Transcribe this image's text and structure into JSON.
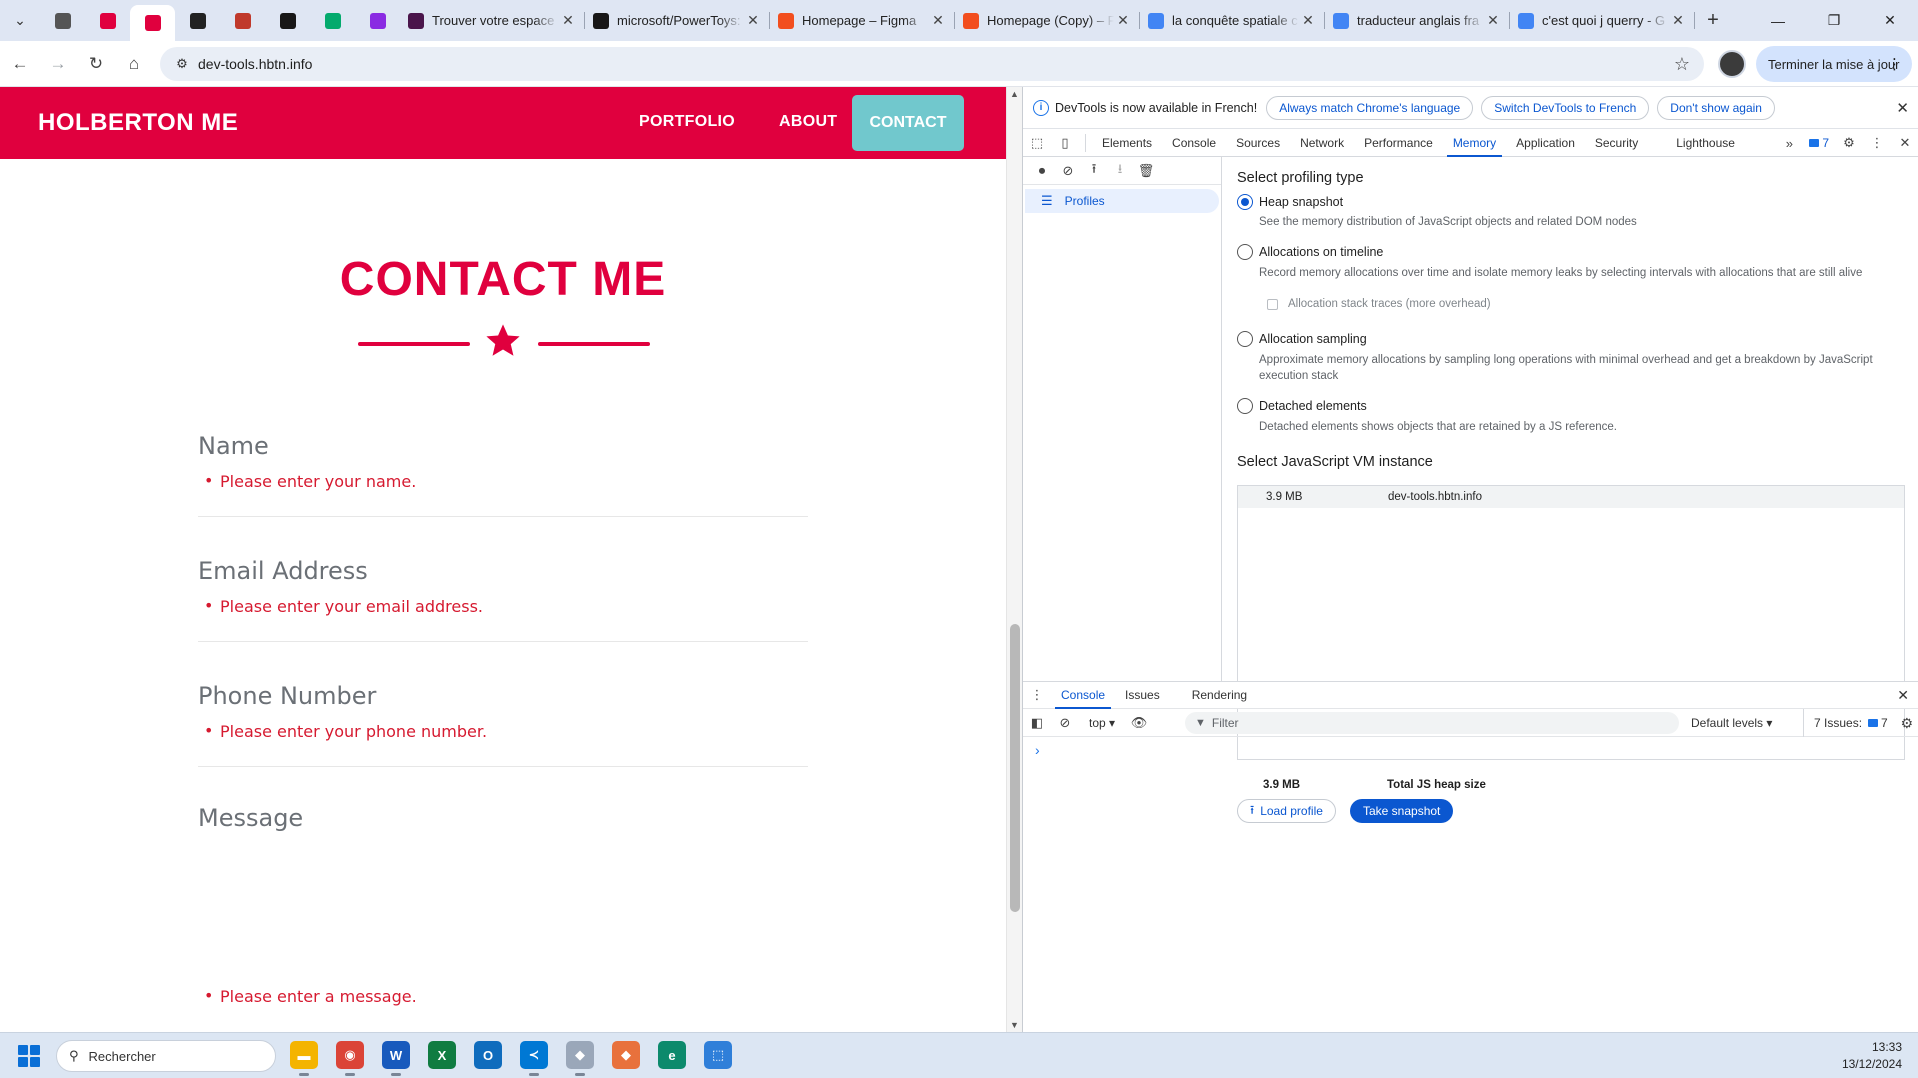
{
  "browser": {
    "pinned_tabs": [
      {
        "icon": "chrome-icon",
        "color": "#555555"
      },
      {
        "icon": "holberton-icon",
        "color": "#e0003e"
      },
      {
        "icon": "holberton-icon",
        "color": "#e0003e"
      },
      {
        "icon": "letter-l-icon",
        "color": "#222222"
      },
      {
        "icon": "clipboard-icon",
        "color": "#c0392b"
      },
      {
        "icon": "github-icon",
        "color": "#181717"
      },
      {
        "icon": "w3schools-icon",
        "color": "#04aa6d"
      },
      {
        "icon": "gem-icon",
        "color": "#8a2be2"
      }
    ],
    "tabs": [
      {
        "title": "Trouver votre espace",
        "icon": "slack-icon",
        "color": "#4a154b"
      },
      {
        "title": "microsoft/PowerToys:",
        "icon": "github-icon",
        "color": "#181717"
      },
      {
        "title": "Homepage – Figma",
        "icon": "figma-icon",
        "color": "#f24e1e"
      },
      {
        "title": "Homepage (Copy) – F",
        "icon": "figma-icon",
        "color": "#f24e1e"
      },
      {
        "title": "la conquête spatiale c",
        "icon": "google-icon",
        "color": "#4285f4"
      },
      {
        "title": "traducteur anglais fra",
        "icon": "google-icon",
        "color": "#4285f4"
      },
      {
        "title": "c'est quoi j querry - G",
        "icon": "google-icon",
        "color": "#4285f4"
      }
    ],
    "url": "dev-tools.hbtn.info",
    "update_label": "Terminer la mise à jour"
  },
  "site": {
    "brand": "HOLBERTON ME",
    "nav": [
      "PORTFOLIO",
      "ABOUT",
      "CONTACT"
    ],
    "title": "CONTACT ME",
    "accent": "#e0003e",
    "contact_bg": "#71c8cd",
    "fields": [
      {
        "label": "Name",
        "error": "Please enter your name."
      },
      {
        "label": "Email Address",
        "error": "Please enter your email address."
      },
      {
        "label": "Phone Number",
        "error": "Please enter your phone number."
      },
      {
        "label": "Message",
        "error": "Please enter a message."
      }
    ]
  },
  "devtools": {
    "banner_text": "DevTools is now available in French!",
    "banner_buttons": [
      "Always match Chrome's language",
      "Switch DevTools to French",
      "Don't show again"
    ],
    "tabs": [
      "Elements",
      "Console",
      "Sources",
      "Network",
      "Performance",
      "Memory",
      "Application",
      "Security",
      "Lighthouse"
    ],
    "active_tab": "Memory",
    "issues_badge": "7",
    "sidebar_item": "Profiles",
    "profiling_heading": "Select profiling type",
    "options": [
      {
        "label": "Heap snapshot",
        "desc": "See the memory distribution of JavaScript objects and related DOM nodes",
        "selected": true
      },
      {
        "label": "Allocations on timeline",
        "desc": "Record memory allocations over time and isolate memory leaks by selecting intervals with allocations that are still alive",
        "selected": false
      },
      {
        "label": "Allocation sampling",
        "desc": "Approximate memory allocations by sampling long operations with minimal overhead and get a breakdown by JavaScript execution stack",
        "selected": false
      },
      {
        "label": "Detached elements",
        "desc": "Detached elements shows objects that are retained by a JS reference.",
        "selected": false
      }
    ],
    "stack_traces_label": "Allocation stack traces (more overhead)",
    "vm_heading": "Select JavaScript VM instance",
    "vm_row": {
      "size": "3.9 MB",
      "name": "dev-tools.hbtn.info"
    },
    "heap_total": {
      "size": "3.9 MB",
      "label": "Total JS heap size"
    },
    "load_label": "Load profile",
    "snapshot_label": "Take snapshot",
    "drawer_tabs": [
      "Console",
      "Issues",
      "Rendering"
    ],
    "context": "top",
    "filter_placeholder": "Filter",
    "levels": "Default levels",
    "issues_label": "7 Issues:",
    "issues_count": "7"
  },
  "taskbar": {
    "search_placeholder": "Rechercher",
    "apps": [
      {
        "icon": "file-explorer-icon",
        "color": "#f4b400",
        "glyph": "▬"
      },
      {
        "icon": "chrome-icon",
        "color": "#db4437",
        "glyph": "◉"
      },
      {
        "icon": "word-icon",
        "color": "#185abd",
        "glyph": "W"
      },
      {
        "icon": "excel-icon",
        "color": "#107c41",
        "glyph": "X"
      },
      {
        "icon": "outlook-icon",
        "color": "#0f6cbd",
        "glyph": "O"
      },
      {
        "icon": "vscode-icon",
        "color": "#0078d4",
        "glyph": "≺"
      },
      {
        "icon": "app-gem-icon",
        "color": "#9aa7b9",
        "glyph": "◆"
      },
      {
        "icon": "git-kraken-icon",
        "color": "#e8713c",
        "glyph": "◆"
      },
      {
        "icon": "edge-icon",
        "color": "#0c8a6c",
        "glyph": "e"
      },
      {
        "icon": "store-icon",
        "color": "#2f7fd9",
        "glyph": "⬚"
      }
    ],
    "time": "13:33",
    "date": "13/12/2024"
  }
}
